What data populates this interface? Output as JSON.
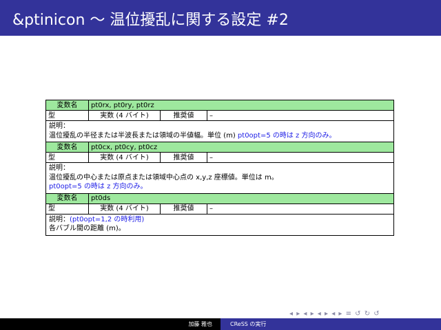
{
  "title": "&ptinicon 〜 温位擾乱に関する設定 #2",
  "table": {
    "var_label": "変数名",
    "type_label": "型",
    "rec_label": "推奨値",
    "desc_label": "説明：",
    "entries": [
      {
        "names": "pt0rx, pt0ry, pt0rz",
        "type": "実数 (4 バイト)",
        "rec": "–",
        "desc_text": "温位擾乱の半径または半波長または領域の半値幅。単位 (m)",
        "desc_blue": "pt0opt=5 の時は z 方向のみ。"
      },
      {
        "names": "pt0cx, pt0cy, pt0cz",
        "type": "実数 (4 バイト)",
        "rec": "–",
        "desc_text": "温位擾乱の中心または原点または領域中心点の x,y,z 座標値。単位は m。",
        "desc_blue": "pt0opt=5 の時は z 方向のみ。"
      },
      {
        "names": "pt0ds",
        "type": "実数 (4 バイト)",
        "rec": "–",
        "desc_blue": "(pt0opt=1,2 の時利用)",
        "desc_text": "各バブル間の距離 (m)。"
      }
    ]
  },
  "nav_symbols": "◂ ▸ ◂ ▸ ◂ ▸ ◂ ▸   ≡   ↺ ↻ ↺",
  "footer": {
    "author": "加藤 雅也",
    "title": "CReSS の実行"
  }
}
